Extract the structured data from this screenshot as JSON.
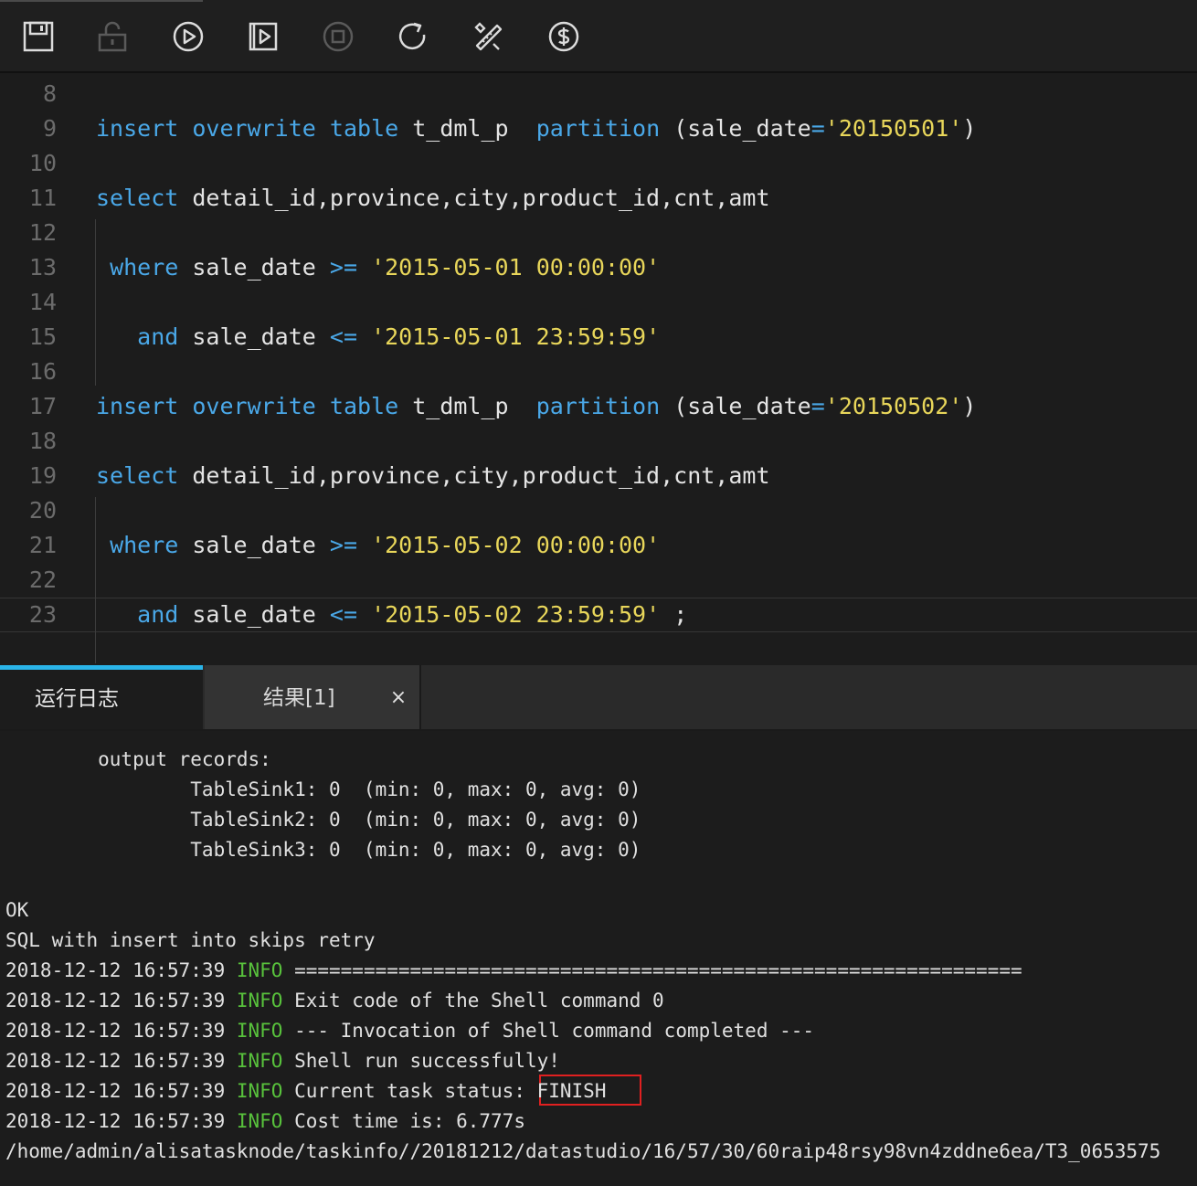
{
  "toolbar": {
    "buttons": [
      {
        "name": "save",
        "icon": "save-icon",
        "enabled": true
      },
      {
        "name": "lock",
        "icon": "lock-icon",
        "enabled": false
      },
      {
        "name": "run",
        "icon": "play-circle-icon",
        "enabled": true
      },
      {
        "name": "run-with-params",
        "icon": "play-square-icon",
        "enabled": true
      },
      {
        "name": "stop",
        "icon": "stop-circle-icon",
        "enabled": false
      },
      {
        "name": "reload",
        "icon": "reload-icon",
        "enabled": true
      },
      {
        "name": "format",
        "icon": "format-tools-icon",
        "enabled": true
      },
      {
        "name": "cost",
        "icon": "dollar-circle-icon",
        "enabled": true
      }
    ]
  },
  "editor": {
    "lines": [
      {
        "num": "8",
        "tokens": []
      },
      {
        "num": "9",
        "tokens": [
          {
            "t": "insert",
            "c": "kw"
          },
          {
            "t": " ",
            "c": "pn"
          },
          {
            "t": "overwrite",
            "c": "kw"
          },
          {
            "t": " ",
            "c": "pn"
          },
          {
            "t": "table",
            "c": "kw"
          },
          {
            "t": " t_dml_p  ",
            "c": "pn"
          },
          {
            "t": "partition",
            "c": "kw"
          },
          {
            "t": " (sale_date",
            "c": "pn"
          },
          {
            "t": "=",
            "c": "op"
          },
          {
            "t": "'20150501'",
            "c": "str"
          },
          {
            "t": ")",
            "c": "pn"
          }
        ]
      },
      {
        "num": "10",
        "tokens": []
      },
      {
        "num": "11",
        "tokens": [
          {
            "t": "select",
            "c": "kw"
          },
          {
            "t": " detail_id,province,city,product_id,cnt,amt",
            "c": "pn"
          }
        ]
      },
      {
        "num": "12",
        "tokens": []
      },
      {
        "num": "13",
        "tokens": [
          {
            "t": " ",
            "c": "pn"
          },
          {
            "t": "where",
            "c": "kw"
          },
          {
            "t": " sale_date ",
            "c": "pn"
          },
          {
            "t": ">=",
            "c": "op"
          },
          {
            "t": " ",
            "c": "pn"
          },
          {
            "t": "'2015-05-01 00:00:00'",
            "c": "str"
          }
        ]
      },
      {
        "num": "14",
        "tokens": []
      },
      {
        "num": "15",
        "tokens": [
          {
            "t": "   ",
            "c": "pn"
          },
          {
            "t": "and",
            "c": "kw"
          },
          {
            "t": " sale_date ",
            "c": "pn"
          },
          {
            "t": "<=",
            "c": "op"
          },
          {
            "t": " ",
            "c": "pn"
          },
          {
            "t": "'2015-05-01 23:59:59'",
            "c": "str"
          }
        ]
      },
      {
        "num": "16",
        "tokens": []
      },
      {
        "num": "17",
        "tokens": [
          {
            "t": "insert",
            "c": "kw"
          },
          {
            "t": " ",
            "c": "pn"
          },
          {
            "t": "overwrite",
            "c": "kw"
          },
          {
            "t": " ",
            "c": "pn"
          },
          {
            "t": "table",
            "c": "kw"
          },
          {
            "t": " t_dml_p  ",
            "c": "pn"
          },
          {
            "t": "partition",
            "c": "kw"
          },
          {
            "t": " (sale_date",
            "c": "pn"
          },
          {
            "t": "=",
            "c": "op"
          },
          {
            "t": "'20150502'",
            "c": "str"
          },
          {
            "t": ")",
            "c": "pn"
          }
        ]
      },
      {
        "num": "18",
        "tokens": []
      },
      {
        "num": "19",
        "tokens": [
          {
            "t": "select",
            "c": "kw"
          },
          {
            "t": " detail_id,province,city,product_id,cnt,amt",
            "c": "pn"
          }
        ]
      },
      {
        "num": "20",
        "tokens": []
      },
      {
        "num": "21",
        "tokens": [
          {
            "t": " ",
            "c": "pn"
          },
          {
            "t": "where",
            "c": "kw"
          },
          {
            "t": " sale_date ",
            "c": "pn"
          },
          {
            "t": ">=",
            "c": "op"
          },
          {
            "t": " ",
            "c": "pn"
          },
          {
            "t": "'2015-05-02 00:00:00'",
            "c": "str"
          }
        ]
      },
      {
        "num": "22",
        "tokens": []
      },
      {
        "num": "23",
        "tokens": [
          {
            "t": "   ",
            "c": "pn"
          },
          {
            "t": "and",
            "c": "kw"
          },
          {
            "t": " sale_date ",
            "c": "pn"
          },
          {
            "t": "<=",
            "c": "op"
          },
          {
            "t": " ",
            "c": "pn"
          },
          {
            "t": "'2015-05-02 23:59:59'",
            "c": "str"
          },
          {
            "t": " ;",
            "c": "pn"
          }
        ]
      }
    ]
  },
  "tabs": {
    "log_label": "运行日志",
    "result_label": "结果[1]",
    "close_glyph": "×"
  },
  "log": {
    "lines": [
      {
        "text": "        output records:"
      },
      {
        "text": "                TableSink1: 0  (min: 0, max: 0, avg: 0)"
      },
      {
        "text": "                TableSink2: 0  (min: 0, max: 0, avg: 0)"
      },
      {
        "text": "                TableSink3: 0  (min: 0, max: 0, avg: 0)"
      },
      {
        "text": ""
      },
      {
        "text": "OK"
      },
      {
        "text": "SQL with insert into skips retry"
      },
      {
        "ts": "2018-12-12 16:57:39",
        "level": "INFO",
        "msg": " ==============================================================="
      },
      {
        "ts": "2018-12-12 16:57:39",
        "level": "INFO",
        "msg": " Exit code of the Shell command 0"
      },
      {
        "ts": "2018-12-12 16:57:39",
        "level": "INFO",
        "msg": " --- Invocation of Shell command completed ---"
      },
      {
        "ts": "2018-12-12 16:57:39",
        "level": "INFO",
        "msg": " Shell run successfully!"
      },
      {
        "ts": "2018-12-12 16:57:39",
        "level": "INFO",
        "msg": " Current task status: FINISH"
      },
      {
        "ts": "2018-12-12 16:57:39",
        "level": "INFO",
        "msg": " Cost time is: 6.777s"
      },
      {
        "text": "/home/admin/alisatasknode/taskinfo//20181212/datastudio/16/57/30/60raip48rsy98vn4zddne6ea/T3_0653575"
      }
    ]
  },
  "colors": {
    "keyword": "#4aa8e8",
    "string": "#e8d65a",
    "info": "#58c23c",
    "highlight_box": "#e02020",
    "tab_accent": "#2ab4e8"
  }
}
